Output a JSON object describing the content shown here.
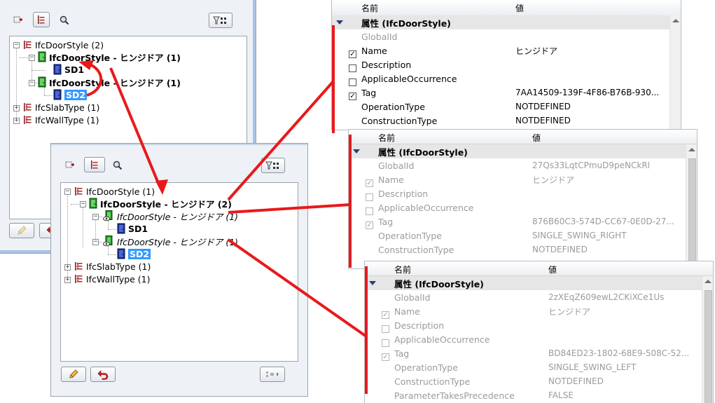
{
  "tree_top": {
    "nodes": [
      {
        "label": "IfcDoorStyle (2)"
      },
      {
        "label": "IfcDoorStyle - ヒンジドア (1)"
      },
      {
        "label": "SD1"
      },
      {
        "label": "IfcDoorStyle - ヒンジドア (1)"
      },
      {
        "label": "SD2"
      },
      {
        "label": "IfcSlabType (1)"
      },
      {
        "label": "IfcWallType (1)"
      }
    ]
  },
  "tree_main": {
    "nodes": [
      {
        "label": "IfcDoorStyle (1)"
      },
      {
        "label": "IfcDoorStyle - ヒンジドア (2)"
      },
      {
        "label": "IfcDoorStyle - ヒンジドア (1)"
      },
      {
        "label": "SD1"
      },
      {
        "label": "IfcDoorStyle - ヒンジドア (1)"
      },
      {
        "label": "SD2"
      },
      {
        "label": "IfcSlabType (1)"
      },
      {
        "label": "IfcWallType (1)"
      }
    ]
  },
  "grid1": {
    "col_name": "名前",
    "col_value": "値",
    "category": "属性 (IfcDoorStyle)",
    "rows": [
      {
        "name": "GlobalId",
        "value": "",
        "checkbox": "none",
        "dim": true
      },
      {
        "name": "Name",
        "value": "ヒンジドア",
        "checkbox": "checked",
        "dim": false
      },
      {
        "name": "Description",
        "value": "",
        "checkbox": "unchecked",
        "dim": false
      },
      {
        "name": "ApplicableOccurrence",
        "value": "",
        "checkbox": "unchecked",
        "dim": false
      },
      {
        "name": "Tag",
        "value": "7AA14509-139F-4F86-B76B-930...",
        "checkbox": "checked",
        "dim": false
      },
      {
        "name": "OperationType",
        "value": "NOTDEFINED",
        "checkbox": "none",
        "dim": false
      },
      {
        "name": "ConstructionType",
        "value": "NOTDEFINED",
        "checkbox": "none",
        "dim": false
      }
    ]
  },
  "grid2": {
    "col_name": "名前",
    "col_value": "値",
    "category": "属性 (IfcDoorStyle)",
    "rows": [
      {
        "name": "GlobalId",
        "value": "27Qs33LqtCPmuD9peNCkRl",
        "checkbox": "none"
      },
      {
        "name": "Name",
        "value": "ヒンジドア",
        "checkbox": "checked"
      },
      {
        "name": "Description",
        "value": "",
        "checkbox": "unchecked"
      },
      {
        "name": "ApplicableOccurrence",
        "value": "",
        "checkbox": "unchecked"
      },
      {
        "name": "Tag",
        "value": "876B60C3-574D-CC67-0E0D-27...",
        "checkbox": "checked"
      },
      {
        "name": "OperationType",
        "value": "SINGLE_SWING_RIGHT",
        "checkbox": "none"
      },
      {
        "name": "ConstructionType",
        "value": "NOTDEFINED",
        "checkbox": "none"
      }
    ]
  },
  "grid3": {
    "col_name": "名前",
    "col_value": "値",
    "category": "属性 (IfcDoorStyle)",
    "rows": [
      {
        "name": "GlobalId",
        "value": "2zXEqZ609ewL2CKiXCe1Us",
        "checkbox": "none"
      },
      {
        "name": "Name",
        "value": "ヒンジドア",
        "checkbox": "checked"
      },
      {
        "name": "Description",
        "value": "",
        "checkbox": "unchecked"
      },
      {
        "name": "ApplicableOccurrence",
        "value": "",
        "checkbox": "unchecked"
      },
      {
        "name": "Tag",
        "value": "BD84ED23-1802-68E9-508C-52...",
        "checkbox": "checked"
      },
      {
        "name": "OperationType",
        "value": "SINGLE_SWING_LEFT",
        "checkbox": "none"
      },
      {
        "name": "ConstructionType",
        "value": "NOTDEFINED",
        "checkbox": "none"
      },
      {
        "name": "ParameterTakesPrecedence",
        "value": "FALSE",
        "checkbox": "none"
      }
    ]
  },
  "colors": {
    "annotation": "#e8191b",
    "selection": "#3399ff",
    "category_triangle": "#2a3d7a"
  }
}
